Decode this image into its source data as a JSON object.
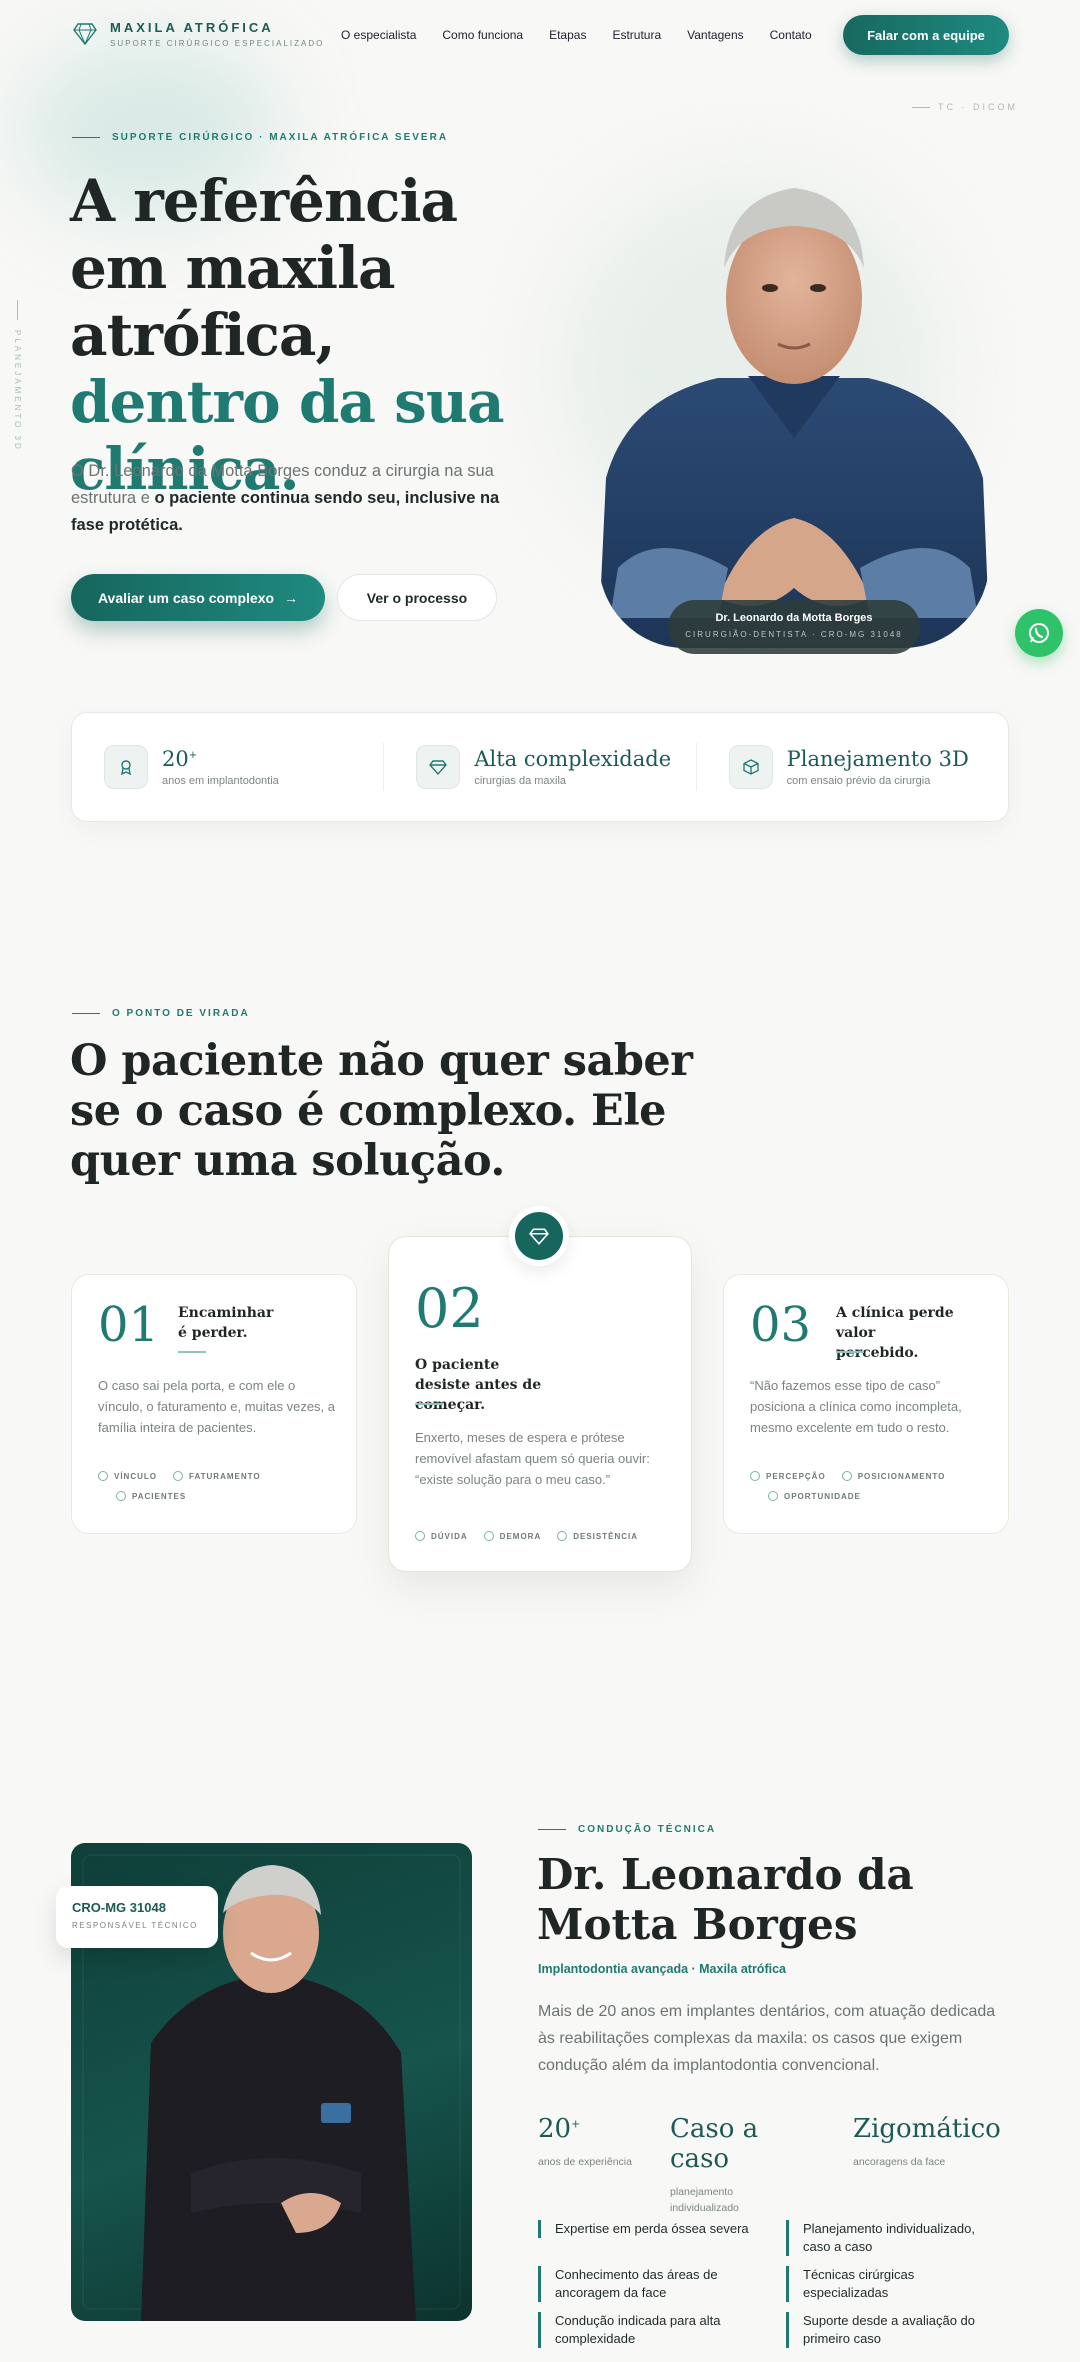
{
  "brand": {
    "name": "MAXILA ATRÓFICA",
    "tagline": "SUPORTE CIRÚRGICO ESPECIALIZADO"
  },
  "nav": [
    "O especialista",
    "Como funciona",
    "Etapas",
    "Estrutura",
    "Vantagens",
    "Contato"
  ],
  "header_cta": "Falar com a equipe",
  "hero": {
    "kicker": "SUPORTE CIRÚRGICO · MAXILA ATRÓFICA SEVERA",
    "tc_dicom": "TC · DICOM",
    "vertical_label": "PLANEJAMENTO 3D",
    "title_dark": "A referência em maxila atrófica,",
    "title_teal": "dentro da sua clínica.",
    "desc_plain": "O Dr. Leonardo da Motta Borges conduz a cirurgia na sua estrutura e ",
    "desc_bold": "o paciente continua sendo seu, inclusive na fase protética.",
    "btn_primary": "Avaliar um caso complexo",
    "btn_secondary": "Ver o processo",
    "doctor_name": "Dr. Leonardo da Motta Borges",
    "doctor_role": "CIRURGIÃO-DENTISTA · CRO-MG 31048"
  },
  "stats": [
    {
      "value": "20",
      "sup": "+",
      "label": "anos em implantodontia",
      "icon": "award-icon"
    },
    {
      "value": "Alta complexidade",
      "sup": "",
      "label": "cirurgias da maxila",
      "icon": "diamond-icon"
    },
    {
      "value": "Planejamento 3D",
      "sup": "",
      "label": "com ensaio prévio da cirurgia",
      "icon": "cube-icon"
    }
  ],
  "turning_point": {
    "kicker": "O PONTO DE VIRADA",
    "title": "O paciente não quer saber se o caso é complexo. Ele quer uma solução.",
    "cards": [
      {
        "num": "01",
        "head": "Encaminhar é perder.",
        "body": "O caso sai pela porta, e com ele o vínculo, o faturamento e, muitas vezes, a família inteira de pacientes.",
        "tags": [
          "VÍNCULO",
          "FATURAMENTO",
          "PACIENTES"
        ]
      },
      {
        "num": "02",
        "head": "O paciente desiste antes de começar.",
        "body": "Enxerto, meses de espera e prótese removível afastam quem só queria ouvir: “existe solução para o meu caso.”",
        "tags": [
          "DÚVIDA",
          "DEMORA",
          "DESISTÊNCIA"
        ]
      },
      {
        "num": "03",
        "head": "A clínica perde valor percebido.",
        "body": "“Não fazemos esse tipo de caso” posiciona a clínica como incompleta, mesmo excelente em tudo o resto.",
        "tags": [
          "PERCEPÇÃO",
          "POSICIONAMENTO",
          "OPORTUNIDADE"
        ]
      }
    ]
  },
  "specialist": {
    "cro": "CRO-MG 31048",
    "cro_role": "RESPONSÁVEL TÉCNICO",
    "kicker": "CONDUÇÃO TÉCNICA",
    "name": "Dr. Leonardo da Motta Borges",
    "subtitle": "Implantodontia avançada · Maxila atrófica",
    "desc": "Mais de 20 anos em implantes dentários, com atuação dedicada às reabilitações complexas da maxila: os casos que exigem condução além da implantodontia convencional.",
    "stats": [
      {
        "value": "20",
        "sup": "+",
        "label": "anos de experiência"
      },
      {
        "value": "Caso a caso",
        "sup": "",
        "label": "planejamento individualizado"
      },
      {
        "value": "Zigomático",
        "sup": "",
        "label": "ancoragens da face"
      }
    ],
    "bullets": [
      "Expertise em perda óssea severa",
      "Planejamento individualizado, caso a caso",
      "Conhecimento das áreas de ancoragem da face",
      "Técnicas cirúrgicas especializadas",
      "Condução indicada para alta complexidade",
      "Suporte desde a avaliação do primeiro caso"
    ]
  },
  "colors": {
    "accent": "#1f7a72",
    "accent_dark": "#16665d",
    "background": "#f8f8f6",
    "whatsapp": "#2ec26a"
  }
}
